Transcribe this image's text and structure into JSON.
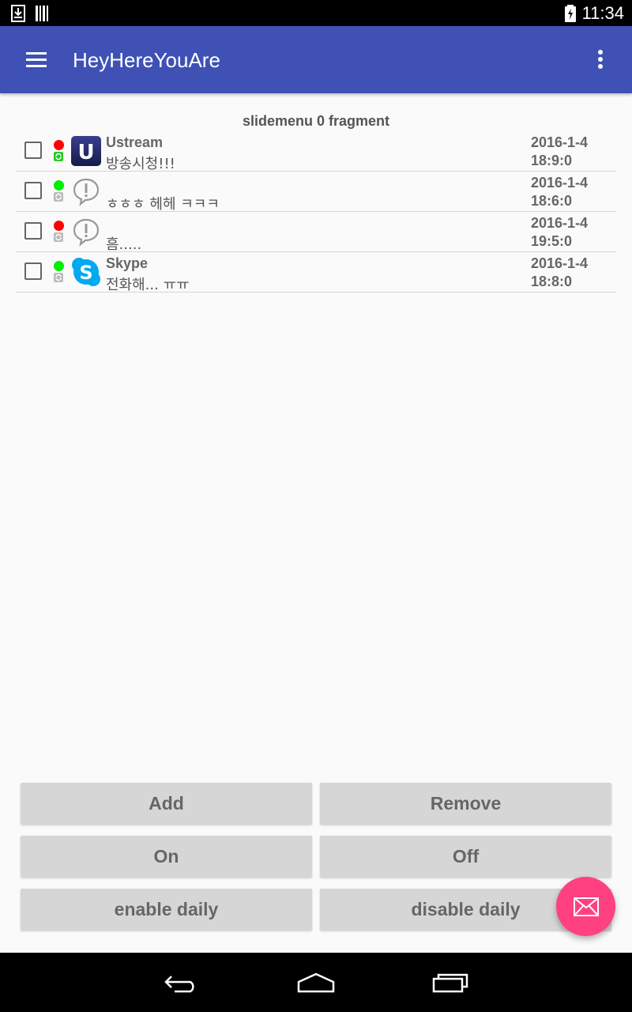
{
  "status_bar": {
    "time": "11:34",
    "icons": [
      "download-icon",
      "barcode-icon",
      "battery-charging-icon"
    ]
  },
  "app_bar": {
    "title": "HeyHereYouAre",
    "menu_icon": "hamburger-menu-icon",
    "overflow_icon": "more-vert-icon"
  },
  "fragment_label": "slidemenu 0 fragment",
  "list": {
    "items": [
      {
        "name": "Ustream",
        "message": "방송시청!!!",
        "date": "2016-1-4",
        "time": "18:9:0",
        "status": "red",
        "sync_active": true,
        "icon": "ustream-icon"
      },
      {
        "name": "",
        "message": "ㅎㅎㅎ 헤헤 ㅋㅋㅋ",
        "date": "2016-1-4",
        "time": "18:6:0",
        "status": "green",
        "sync_active": false,
        "icon": "alert-bubble-icon"
      },
      {
        "name": "",
        "message": "흠.....",
        "date": "2016-1-4",
        "time": "19:5:0",
        "status": "red",
        "sync_active": false,
        "icon": "alert-bubble-icon"
      },
      {
        "name": "Skype",
        "message": "전화해... ㅠㅠ",
        "date": "2016-1-4",
        "time": "18:8:0",
        "status": "green",
        "sync_active": false,
        "icon": "skype-icon"
      }
    ]
  },
  "buttons": {
    "add": "Add",
    "remove": "Remove",
    "on": "On",
    "off": "Off",
    "enable_daily": "enable daily",
    "disable_daily": "disable daily"
  },
  "fab": {
    "icon": "mail-icon"
  },
  "nav_bar": {
    "icons": [
      "back-icon",
      "home-icon",
      "recents-icon"
    ]
  },
  "colors": {
    "primary": "#3F51B5",
    "accent": "#FF4081",
    "status_red": "#FF0000",
    "status_green": "#00FF00"
  }
}
